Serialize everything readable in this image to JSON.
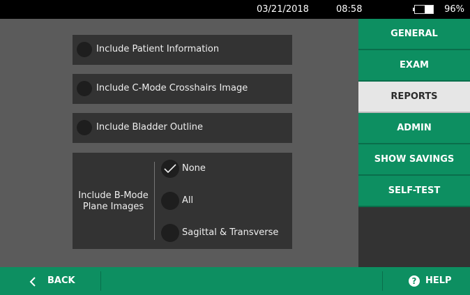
{
  "status": {
    "date": "03/21/2018",
    "time": "08:58",
    "battery_percent": "96%",
    "battery_level": 0.96,
    "battery_icon": "battery-icon"
  },
  "options": [
    {
      "label": "Include Patient Information",
      "checked": false
    },
    {
      "label": "Include C-Mode Crosshairs Image",
      "checked": false
    },
    {
      "label": "Include Bladder Outline",
      "checked": false
    }
  ],
  "bmode": {
    "label": "Include B-Mode Plane Images",
    "choices": [
      {
        "label": "None",
        "selected": true
      },
      {
        "label": "All",
        "selected": false
      },
      {
        "label": "Sagittal & Transverse",
        "selected": false
      }
    ]
  },
  "sidebar": {
    "items": [
      {
        "label": "GENERAL",
        "active": false
      },
      {
        "label": "EXAM",
        "active": false
      },
      {
        "label": "REPORTS",
        "active": true
      },
      {
        "label": "ADMIN",
        "active": false
      },
      {
        "label": "SHOW SAVINGS",
        "active": false
      },
      {
        "label": "SELF-TEST",
        "active": false
      }
    ]
  },
  "footer": {
    "back_label": "BACK",
    "back_icon": "chevron-left-icon",
    "help_label": "HELP",
    "help_icon": "question-icon"
  },
  "colors": {
    "accent_green": "#0d8f61",
    "active_tab_bg": "#e6e6e6",
    "panel_bg": "#333333",
    "page_bg": "#5b5b5b"
  }
}
